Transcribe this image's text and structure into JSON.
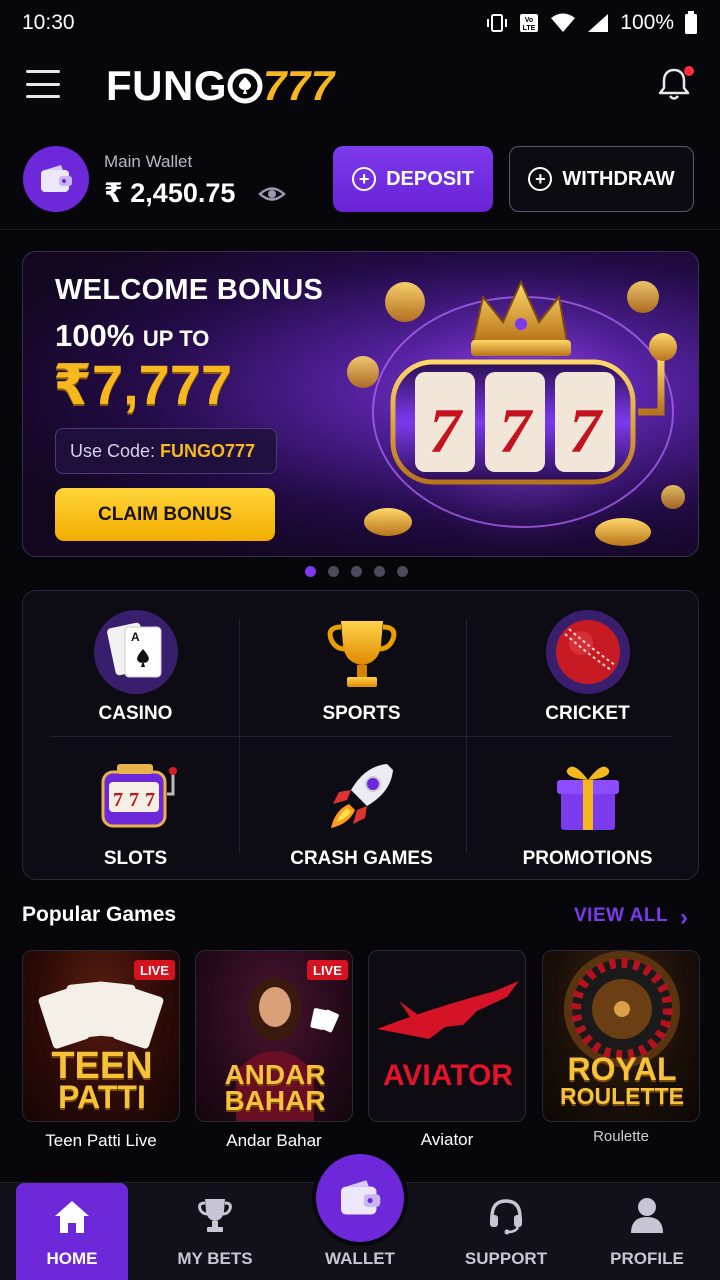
{
  "status_bar": {
    "time": "10:30",
    "battery": "100%"
  },
  "header": {
    "logo_text": "FUNG",
    "logo_num": "777"
  },
  "wallet": {
    "label": "Main Wallet",
    "amount": "₹ 2,450.75",
    "deposit_label": "DEPOSIT",
    "withdraw_label": "WITHDRAW"
  },
  "banner": {
    "title": "WELCOME BONUS",
    "percent": "100%",
    "up_to": "UP TO",
    "amount": "₹7,777",
    "code_prefix": "Use Code:",
    "code": "FUNGO777",
    "cta": "CLAIM BONUS",
    "slide_count": 5,
    "active_slide": 1
  },
  "categories": [
    {
      "label": "CASINO",
      "icon": "cards-icon"
    },
    {
      "label": "SPORTS",
      "icon": "trophy-icon"
    },
    {
      "label": "CRICKET",
      "icon": "cricket-ball-icon"
    },
    {
      "label": "SLOTS",
      "icon": "slot-machine-icon"
    },
    {
      "label": "CRASH GAMES",
      "icon": "rocket-icon"
    },
    {
      "label": "PROMOTIONS",
      "icon": "gift-icon"
    }
  ],
  "popular": {
    "title": "Popular Games",
    "view_all": "VIEW ALL",
    "games": [
      {
        "name": "Teen Patti Live",
        "logo_line1": "TEEN",
        "logo_line2": "PATTI",
        "badge": "LIVE"
      },
      {
        "name": "Andar Bahar",
        "logo_line1": "ANDAR",
        "logo_line2": "BAHAR",
        "badge": "LIVE"
      },
      {
        "name": "Aviator",
        "logo_line1": "AVIATOR",
        "logo_line2": "",
        "badge": ""
      },
      {
        "name": "Roulette",
        "logo_line1": "ROYAL",
        "logo_line2": "ROULETTE",
        "badge": ""
      }
    ]
  },
  "nav": {
    "home": "HOME",
    "my_bets": "MY BETS",
    "wallet": "WALLET",
    "support": "SUPPORT",
    "profile": "PROFILE"
  },
  "colors": {
    "accent": "#6d28d9",
    "gold": "#f6b81f",
    "live": "#d6121e"
  }
}
